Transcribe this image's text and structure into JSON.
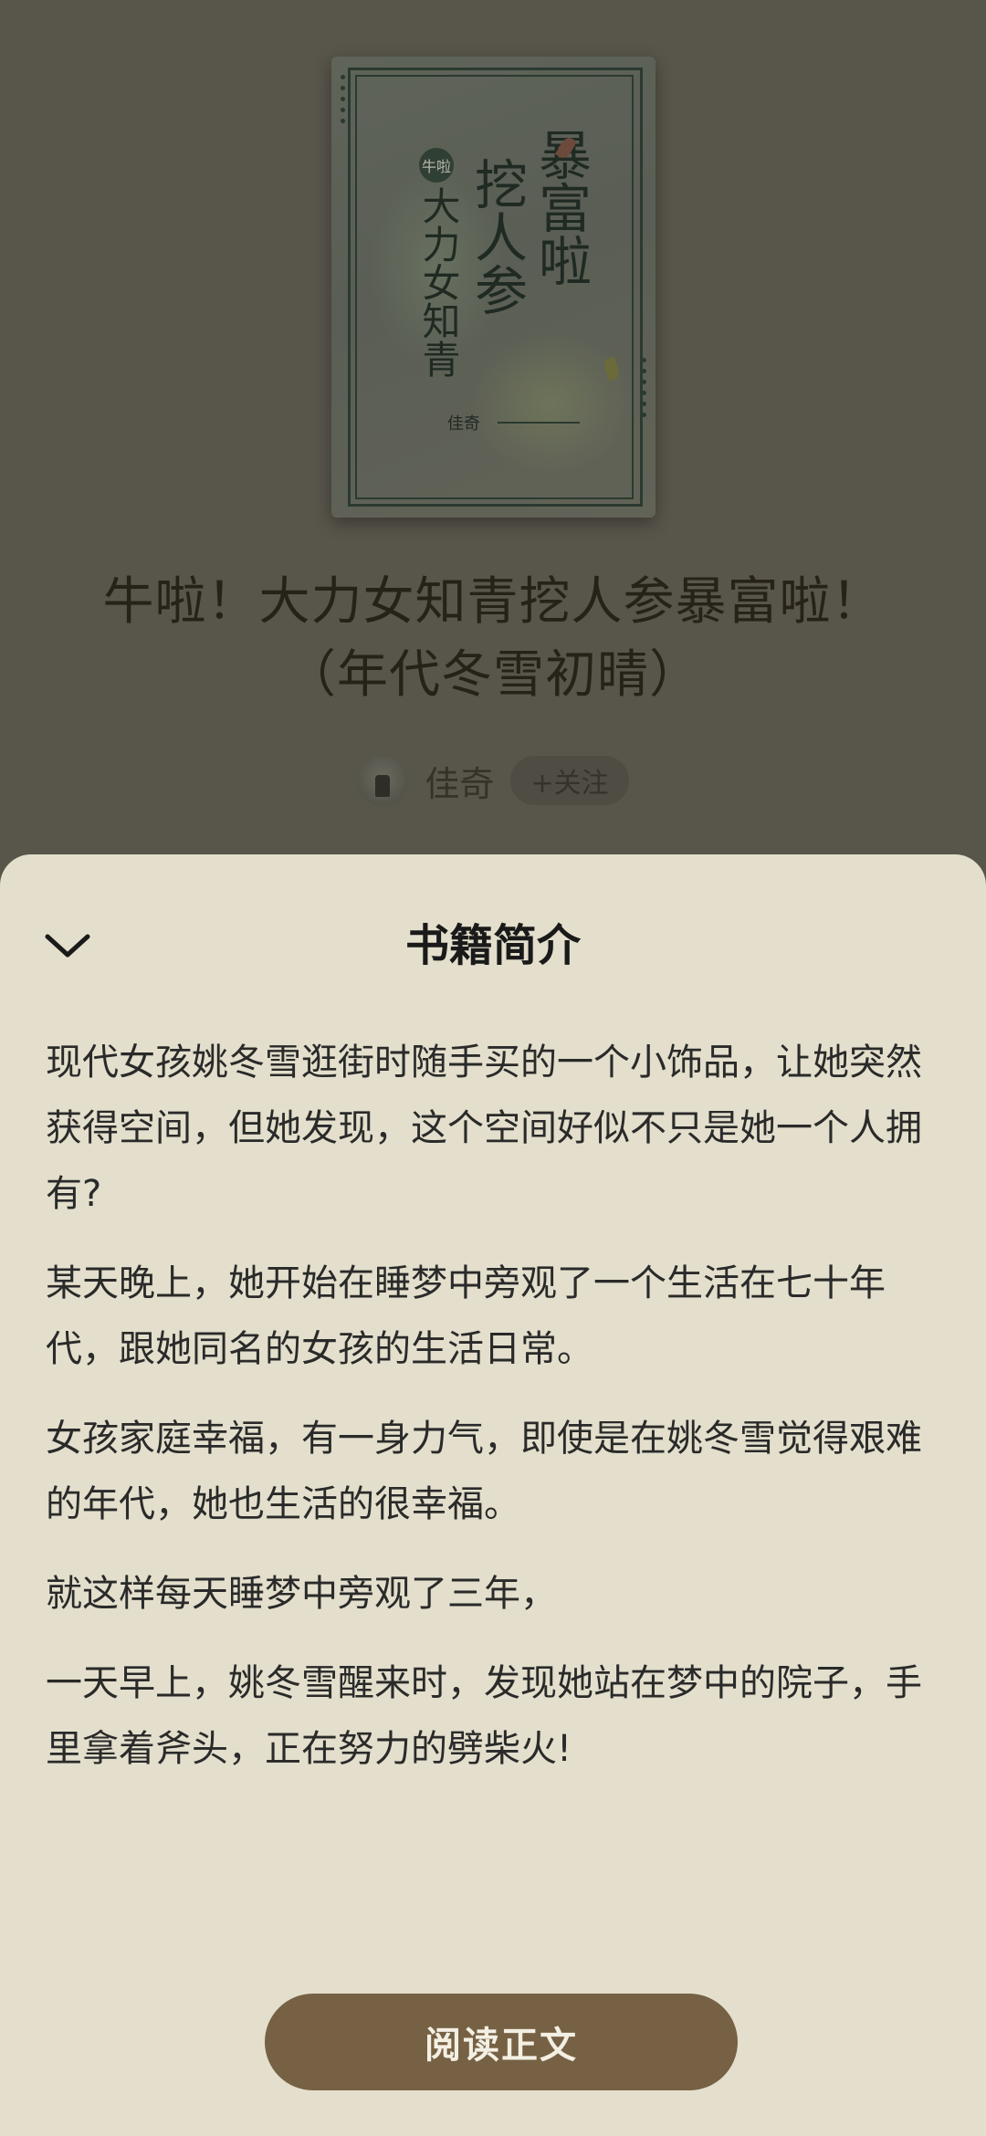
{
  "cover": {
    "badge": "牛啦",
    "col_left": "大力女知青",
    "col_mid": "挖人参",
    "col_right": "暴富啦",
    "author": "佳奇"
  },
  "book": {
    "title": "牛啦！大力女知青挖人参暴富啦！（年代冬雪初晴）",
    "author_name": "佳奇",
    "follow_label": "+关注"
  },
  "sheet": {
    "title": "书籍简介",
    "collapse_icon": "chevron-down-icon",
    "paragraphs": [
      "现代女孩姚冬雪逛街时随手买的一个小饰品，让她突然获得空间，但她发现，这个空间好似不只是她一个人拥有?",
      "某天晚上，她开始在睡梦中旁观了一个生活在七十年代，跟她同名的女孩的生活日常。",
      "女孩家庭幸福，有一身力气，即使是在姚冬雪觉得艰难的年代，她也生活的很幸福。",
      "就这样每天睡梦中旁观了三年，",
      "一天早上，姚冬雪醒来时，发现她站在梦中的院子，手里拿着斧头，正在努力的劈柴火!"
    ],
    "read_button": "阅读正文"
  },
  "colors": {
    "overlay_bg": "#58554b",
    "sheet_bg": "#e3dfcc",
    "button_bg": "#766144"
  }
}
